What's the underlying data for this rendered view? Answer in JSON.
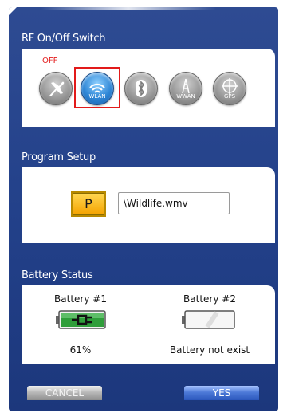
{
  "rf_section": {
    "title": "RF On/Off Switch",
    "status": "OFF",
    "buttons": [
      {
        "name": "airplane",
        "label": ""
      },
      {
        "name": "wlan",
        "label": "WLAN"
      },
      {
        "name": "bluetooth",
        "label": ""
      },
      {
        "name": "wwan",
        "label": "WWAN"
      },
      {
        "name": "gps",
        "label": "GPS"
      }
    ]
  },
  "program_section": {
    "title": "Program Setup",
    "button_label": "P",
    "file_value": "\\Wildlife.wmv"
  },
  "battery_section": {
    "title": "Battery Status",
    "battery1": {
      "label": "Battery #1",
      "status": "61%"
    },
    "battery2": {
      "label": "Battery #2",
      "status": "Battery not exist"
    }
  },
  "footer": {
    "cancel_label": "CANCEL",
    "yes_label": "YES"
  },
  "colors": {
    "dialog_bg": "#23418a",
    "off_red": "#e31b1b",
    "wlan_blue": "#2f87d6",
    "battery_green": "#2f9e3a",
    "selection_red": "#e21a1a"
  }
}
